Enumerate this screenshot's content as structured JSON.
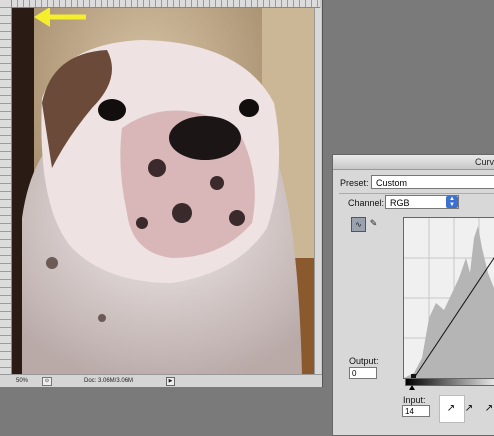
{
  "document": {
    "zoom_level": "50%",
    "doc_size": "Doc: 3.06M/3.06M",
    "zoom_button_glyph": "⊙",
    "status_arrow_glyph": "▶"
  },
  "annotation": {
    "arrow_color": "#f4ef2a",
    "arrow_icon": "arrow-left-icon"
  },
  "curves_dialog": {
    "title": "Curv",
    "preset_label": "Preset:",
    "preset_value": "Custom",
    "channel_label": "Channel:",
    "channel_value": "RGB",
    "channel_arrows_glyph": "▲\n▼",
    "curve_tool_glyph": "∿",
    "pencil_tool_glyph": "✎",
    "output_label": "Output:",
    "output_value": "0",
    "input_label": "Input:",
    "input_value": "14",
    "eyedropper_glyph": "↗",
    "highlight_color": "#ffffff"
  }
}
